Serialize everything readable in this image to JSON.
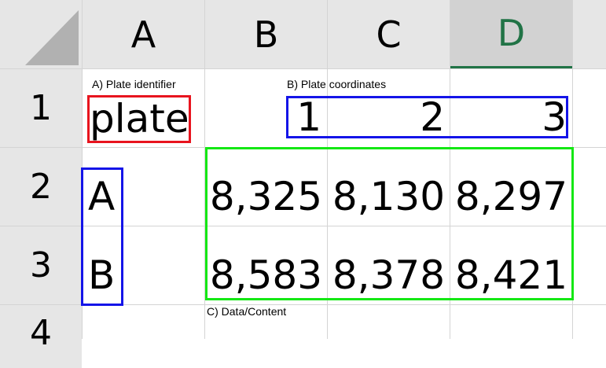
{
  "columns": [
    "A",
    "B",
    "C",
    "D"
  ],
  "rows": [
    "1",
    "2",
    "3",
    "4"
  ],
  "cells": {
    "a1": "plate",
    "b1": "",
    "c1_coord1": "1",
    "c1_coord2": "2",
    "d1": "3",
    "a2": "A",
    "a3": "B",
    "b2": "8,325",
    "c2": "8,130",
    "d2": "8,297",
    "b3": "8,583",
    "c3": "8,378",
    "d3": "8,421"
  },
  "annotations": {
    "plate_identifier": "A) Plate identifier",
    "plate_coordinates": "B) Plate coordinates",
    "data_content": "C) Data/Content"
  },
  "colors": {
    "identifier_box": "#e8141e",
    "coordinates_box": "#1414e8",
    "data_box": "#14e814",
    "selected_column_text": "#217346"
  }
}
